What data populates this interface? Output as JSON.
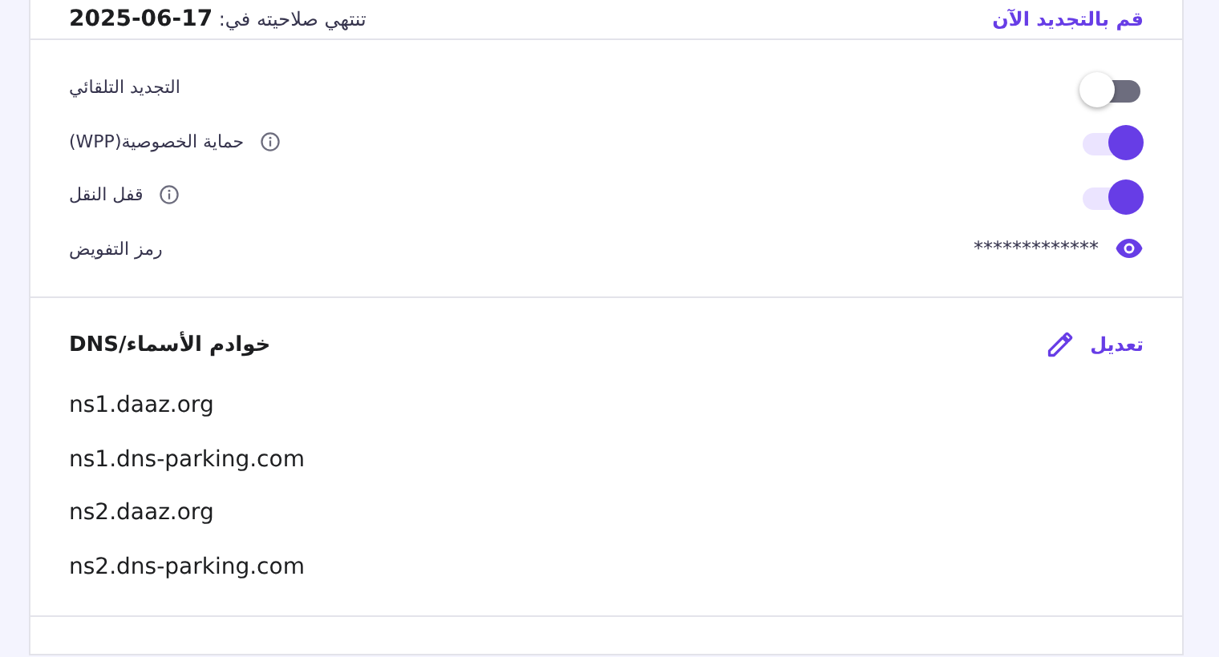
{
  "header": {
    "expiry_text": "تنتهي صلاحيته في: **17-06-2025**",
    "renew_link": "قم بالتجديد الآن"
  },
  "settings": [
    {
      "kind": "toggle",
      "label": "التجديد التلقائي",
      "info": false,
      "on": false
    },
    {
      "kind": "toggle",
      "label": "حماية الخصوصية(WPP)",
      "info": true,
      "on": true
    },
    {
      "kind": "toggle",
      "label": "قفل النقل",
      "info": true,
      "on": true
    },
    {
      "kind": "secret",
      "label": "رمز التفويض",
      "info": false,
      "value": "*************"
    }
  ],
  "nameservers": {
    "title": "خوادم الأسماء/DNS",
    "edit_link": "تعديل",
    "items": [
      "ns1.daaz.org",
      "ns1.dns-parking.com",
      "ns2.daaz.org",
      "ns2.dns-parking.com"
    ]
  }
}
